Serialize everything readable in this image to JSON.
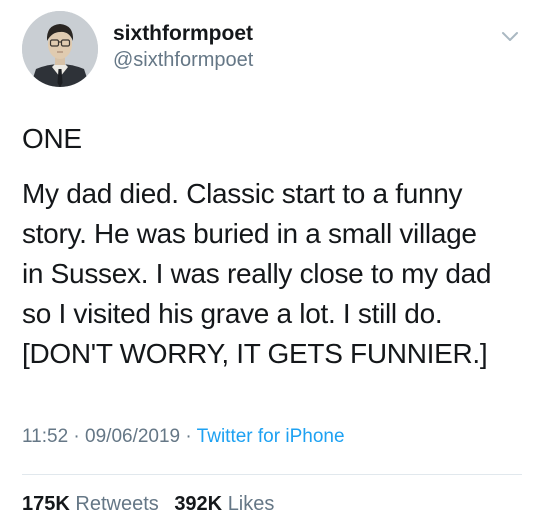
{
  "author": {
    "display_name": "sixthformpoet",
    "handle": "@sixthformpoet",
    "avatar_icon": "portrait-avatar-icon"
  },
  "menu_icon": "chevron-down-icon",
  "tweet": {
    "heading": "ONE",
    "lines": [
      "My dad died. Classic start to a funny",
      "story. He was buried in a small village",
      "in Sussex. I was really close to my dad",
      "so I visited his grave a lot. I still do.",
      "[DON'T WORRY, IT GETS FUNNIER.]"
    ]
  },
  "meta": {
    "time": "11:52",
    "date": "09/06/2019",
    "separator": "·",
    "source": "Twitter for iPhone"
  },
  "stats": {
    "retweets_count": "175K",
    "retweets_label": "Retweets",
    "likes_count": "392K",
    "likes_label": "Likes"
  },
  "colors": {
    "text_primary": "#14171a",
    "text_secondary": "#657786",
    "link": "#1da1f2",
    "divider": "#e1e8ed"
  }
}
